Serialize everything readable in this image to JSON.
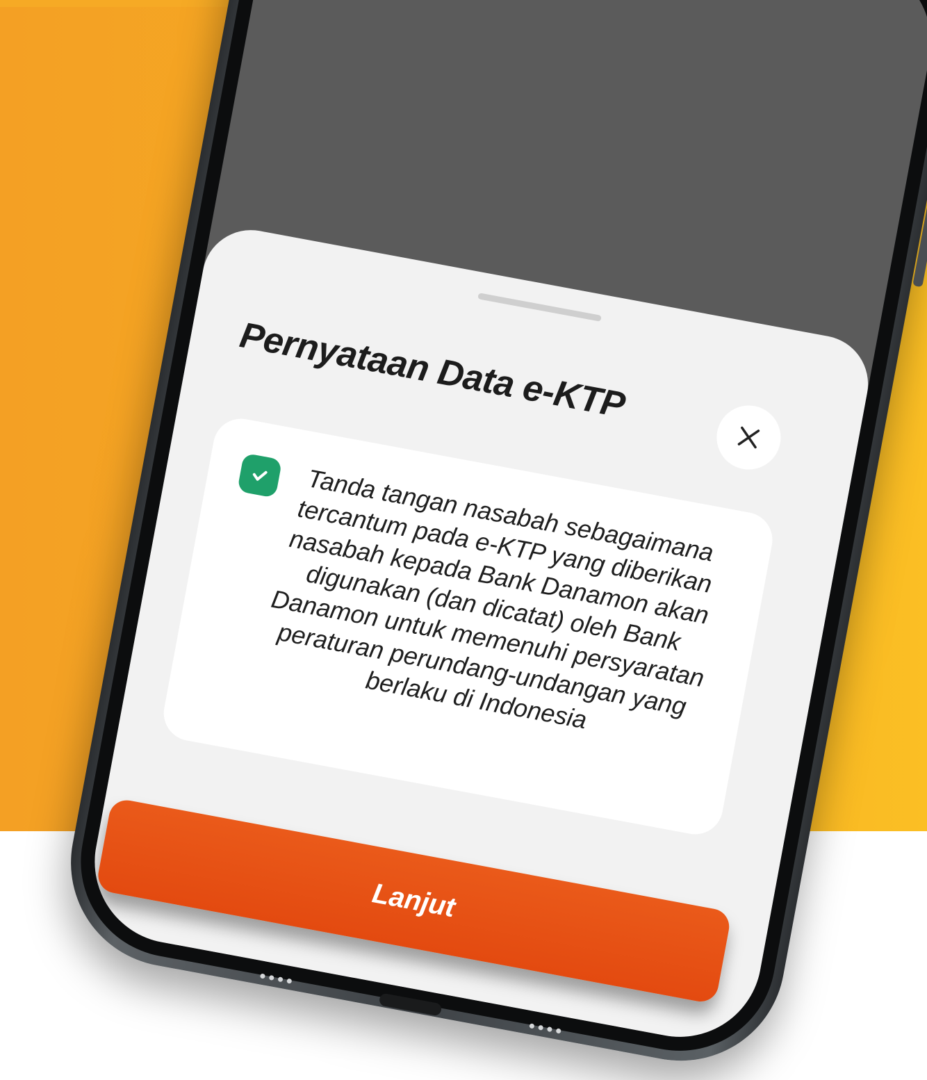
{
  "colors": {
    "background_accent": "#f6ac22",
    "primary_button": "#e34a10",
    "checkbox": "#1fa06a",
    "screen_overlay": "#5b5b5b"
  },
  "modal": {
    "title": "Pernyataan Data e-KTP",
    "close_icon": "close-icon",
    "consent": {
      "checked": true,
      "text": "Tanda tangan nasabah sebagaimana tercantum pada e-KTP yang diberikan nasabah kepada Bank Danamon akan digunakan (dan dicatat) oleh Bank Danamon untuk memenuhi persyaratan peraturan perundang-undangan yang berlaku di Indonesia"
    },
    "primary_button_label": "Lanjut"
  }
}
